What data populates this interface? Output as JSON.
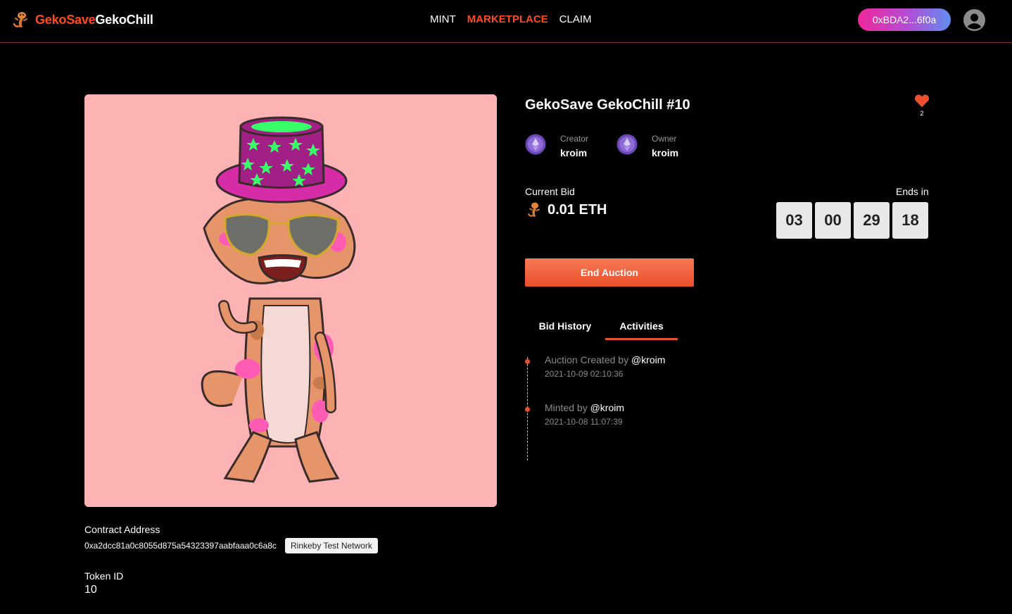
{
  "header": {
    "logo_part1": "GekoSave",
    "logo_part2": "GekoChill",
    "nav": [
      "MINT",
      "MARKETPLACE",
      "CLAIM"
    ],
    "active_nav": "MARKETPLACE",
    "wallet_address": "0xBDA2...6f0a",
    "accent_color": "#ff4a1c"
  },
  "nft": {
    "title": "GekoSave GekoChill #10",
    "likes": "2",
    "creator_label": "Creator",
    "creator_name": "kroim",
    "owner_label": "Owner",
    "owner_name": "kroim",
    "current_bid_label": "Current Bid",
    "current_bid_value": "0.01 ETH",
    "ends_in_label": "Ends in",
    "countdown": [
      "03",
      "00",
      "29",
      "18"
    ],
    "end_auction_label": "End Auction",
    "contract_label": "Contract Address",
    "contract_address": "0xa2dcc81a0c8055d875a54323397aabfaaa0c6a8c",
    "network": "Rinkeby Test Network",
    "token_id_label": "Token ID",
    "token_id": "10"
  },
  "tabs": {
    "bid_history": "Bid History",
    "activities": "Activities",
    "active": "Activities"
  },
  "activities": [
    {
      "action": "Auction Created by",
      "user": "@kroim",
      "time": "2021-10-09 02:10:36"
    },
    {
      "action": "Minted by",
      "user": "@kroim",
      "time": "2021-10-08 11:07:39"
    }
  ],
  "icons": {
    "logo": "gecko-logo-icon",
    "profile": "user-circle-icon",
    "like": "heart-icon",
    "avatar": "ethereum-icon",
    "currency": "gecko-coin-icon"
  }
}
